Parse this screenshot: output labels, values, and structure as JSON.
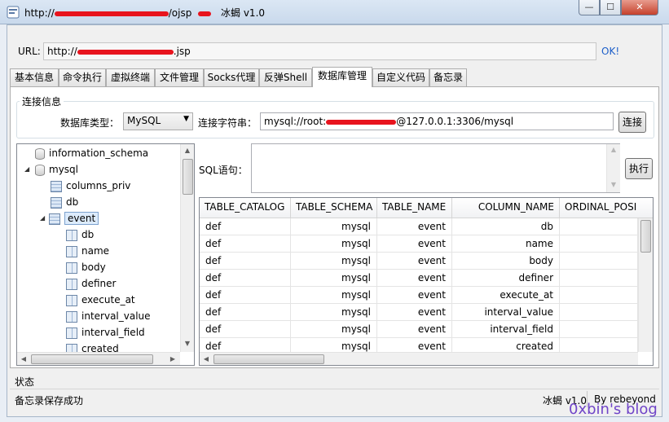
{
  "window": {
    "title_prefix": "http://",
    "title_suffix": "/ojsp",
    "app_name": "冰蝎 v1.0",
    "controls": {
      "minimize": "—",
      "maximize": "☐",
      "close": "✕"
    }
  },
  "url_bar": {
    "label": "URL:",
    "value_prefix": "http://",
    "value_suffix": ".jsp",
    "ok_label": "OK!"
  },
  "tabs": [
    {
      "label": "基本信息"
    },
    {
      "label": "命令执行"
    },
    {
      "label": "虚拟终端"
    },
    {
      "label": "文件管理"
    },
    {
      "label": "Socks代理"
    },
    {
      "label": "反弹Shell"
    },
    {
      "label": "数据库管理",
      "active": true
    },
    {
      "label": "自定义代码"
    },
    {
      "label": "备忘录"
    }
  ],
  "connection": {
    "legend": "连接信息",
    "db_type_label": "数据库类型：",
    "db_type_value": "MySQL",
    "conn_string_label": "连接字符串：",
    "conn_string_prefix": "mysql://root:",
    "conn_string_suffix": "@127.0.0.1:3306/mysql",
    "connect_label": "连接"
  },
  "tree": {
    "items": [
      {
        "label": "information_schema"
      },
      {
        "label": "mysql"
      },
      {
        "label": "columns_priv"
      },
      {
        "label": "db"
      },
      {
        "label": "event"
      },
      {
        "label": "db"
      },
      {
        "label": "name"
      },
      {
        "label": "body"
      },
      {
        "label": "definer"
      },
      {
        "label": "execute_at"
      },
      {
        "label": "interval_value"
      },
      {
        "label": "interval_field"
      },
      {
        "label": "created"
      }
    ]
  },
  "sql": {
    "label": "SQL语句：",
    "value": "",
    "execute_label": "执行"
  },
  "grid": {
    "columns": [
      "TABLE_CATALOG",
      "TABLE_SCHEMA",
      "TABLE_NAME",
      "COLUMN_NAME",
      "ORDINAL_POSI"
    ],
    "rows": [
      [
        "def",
        "mysql",
        "event",
        "db",
        ""
      ],
      [
        "def",
        "mysql",
        "event",
        "name",
        ""
      ],
      [
        "def",
        "mysql",
        "event",
        "body",
        ""
      ],
      [
        "def",
        "mysql",
        "event",
        "definer",
        ""
      ],
      [
        "def",
        "mysql",
        "event",
        "execute_at",
        ""
      ],
      [
        "def",
        "mysql",
        "event",
        "interval_value",
        ""
      ],
      [
        "def",
        "mysql",
        "event",
        "interval_field",
        ""
      ],
      [
        "def",
        "mysql",
        "event",
        "created",
        ""
      ]
    ]
  },
  "status": {
    "label": "状态",
    "message": "备忘录保存成功",
    "app_version": "冰蝎 v1.0",
    "author": "By rebeyond"
  },
  "watermark": "0xbin's blog",
  "colors": {
    "redaction": "#e8141e",
    "link": "#1d5fc9",
    "selection": "#dcebfc"
  }
}
